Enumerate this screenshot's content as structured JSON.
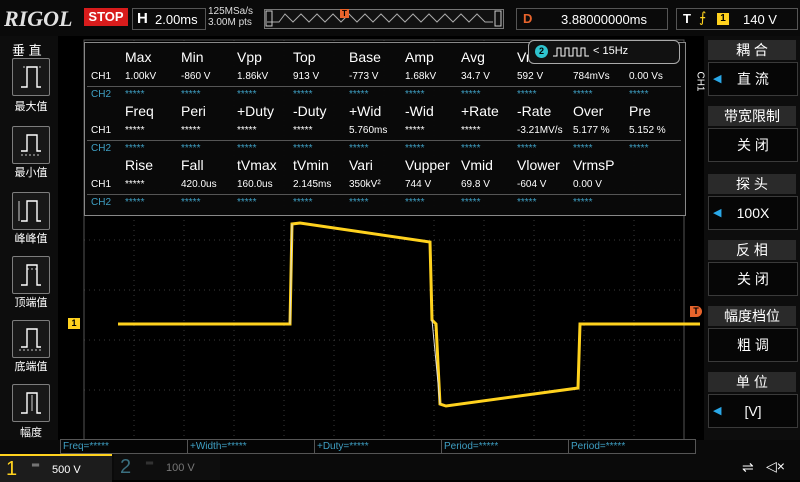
{
  "topbar": {
    "logo": "RIGOL",
    "run_state": "STOP",
    "timebase_label": "H",
    "timebase_value": "2.00ms",
    "sample_rate": "125MSa/s",
    "memory_depth": "3.00M pts",
    "trigger_marker": "T",
    "delay_label": "D",
    "delay_value": "3.88000000ms",
    "trigger_label": "T",
    "trigger_source": "1",
    "trigger_level": "140 V"
  },
  "left_panel": {
    "title": "垂 直",
    "buttons": [
      {
        "label": "最大值",
        "icon": "max-waveform-icon"
      },
      {
        "label": "最小值",
        "icon": "min-waveform-icon"
      },
      {
        "label": "峰峰值",
        "icon": "pkpk-waveform-icon"
      },
      {
        "label": "顶端值",
        "icon": "top-waveform-icon"
      },
      {
        "label": "底端值",
        "icon": "base-waveform-icon"
      },
      {
        "label": "幅度",
        "icon": "amplitude-waveform-icon"
      }
    ]
  },
  "measurements": {
    "section1": {
      "headers": [
        "Max",
        "Min",
        "Vpp",
        "Top",
        "Base",
        "Amp",
        "Avg",
        "Vr",
        "",
        ""
      ],
      "ch1": [
        "1.00kV",
        "-860 V",
        "1.86kV",
        "913 V",
        "-773 V",
        "1.68kV",
        "34.7 V",
        "592 V",
        "784mVs",
        "0.00 Vs"
      ],
      "ch2": [
        "*****",
        "*****",
        "*****",
        "*****",
        "*****",
        "*****",
        "*****",
        "*****",
        "*****",
        "*****"
      ]
    },
    "section2": {
      "headers": [
        "Freq",
        "Peri",
        "+Duty",
        "-Duty",
        "+Wid",
        "-Wid",
        "+Rate",
        "-Rate",
        "Over",
        "Pre"
      ],
      "ch1": [
        "*****",
        "*****",
        "*****",
        "*****",
        "5.760ms",
        "*****",
        "*****",
        "-3.21MV/s",
        "5.177 %",
        "5.152 %"
      ],
      "ch2": [
        "*****",
        "*****",
        "*****",
        "*****",
        "*****",
        "*****",
        "*****",
        "*****",
        "*****",
        "*****"
      ]
    },
    "section3": {
      "headers": [
        "Rise",
        "Fall",
        "tVmax",
        "tVmin",
        "Vari",
        "Vupper",
        "Vmid",
        "Vlower",
        "VrmsP"
      ],
      "ch1": [
        "*****",
        "420.0us",
        "160.0us",
        "2.145ms",
        "350kV²",
        "744 V",
        "69.8 V",
        "-604 V",
        "0.00 V"
      ],
      "ch2": [
        "*****",
        "*****",
        "*****",
        "*****",
        "*****",
        "*****",
        "*****",
        "*****",
        "*****"
      ]
    },
    "row_labels": [
      "CH1",
      "CH2"
    ]
  },
  "freq_counter": {
    "badge": "2",
    "text": "< 15Hz"
  },
  "right_panel": {
    "side_label": "CH1",
    "menus": [
      {
        "title": "耦 合",
        "value": "直 流",
        "has_arrow": true
      },
      {
        "title": "带宽限制",
        "value": "关 闭",
        "has_arrow": false
      },
      {
        "title": "探 头",
        "value": "100X",
        "has_arrow": true
      },
      {
        "title": "反 相",
        "value": "关 闭",
        "has_arrow": false
      },
      {
        "title": "幅度档位",
        "value": "粗 调",
        "has_arrow": false
      },
      {
        "title": "单 位",
        "value": "[V]",
        "has_arrow": true
      }
    ]
  },
  "markers": {
    "ch1_offset": "1",
    "trigger_level": "T"
  },
  "bottom": {
    "freq_cells": [
      "Freq=*****",
      "+Width=*****",
      "+Duty=*****",
      "Period=*****",
      "Period=*****"
    ],
    "ch1": {
      "number": "1",
      "coupling": "═",
      "scale": "500 V"
    },
    "ch2": {
      "number": "2",
      "coupling": "═",
      "scale": "100 V"
    }
  },
  "colors": {
    "ch1": "#ffd21e",
    "ch2": "#2fc4cf",
    "stop": "#d81c1c",
    "trigger": "#e8642c"
  }
}
